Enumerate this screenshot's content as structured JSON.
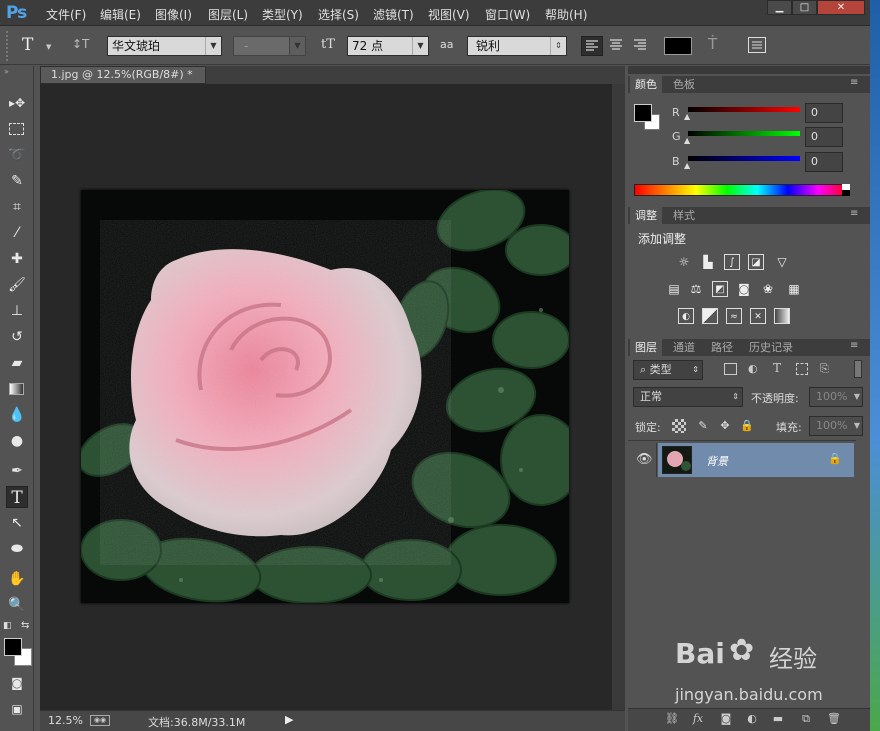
{
  "app": {
    "logo": "Ps"
  },
  "menu": [
    "文件(F)",
    "编辑(E)",
    "图像(I)",
    "图层(L)",
    "类型(Y)",
    "选择(S)",
    "滤镜(T)",
    "视图(V)",
    "窗口(W)",
    "帮助(H)"
  ],
  "window_controls": [
    "minimize-icon",
    "maximize-icon",
    "close-icon"
  ],
  "options": {
    "tool_glyph": "T",
    "orient_glyph": "↕T",
    "font_family": "华文琥珀",
    "font_style": "-",
    "size_glyph": "tT",
    "font_size": "72 点",
    "aa_glyph": "aa",
    "antialias": "锐利",
    "text_color": "#000000"
  },
  "document": {
    "tab_title": "1.jpg @ 12.5%(RGB/8#) *",
    "tab_close": "×",
    "zoom": "12.5%",
    "doc_info": "文档:36.8M/33.1M"
  },
  "color_panel": {
    "tabs": [
      "颜色",
      "色板"
    ],
    "channels": [
      {
        "label": "R",
        "value": "0",
        "gradient": "#ff0000"
      },
      {
        "label": "G",
        "value": "0",
        "gradient": "#00ff00"
      },
      {
        "label": "B",
        "value": "0",
        "gradient": "#0000ff"
      }
    ],
    "foreground": "#000000",
    "background": "#ffffff"
  },
  "adjust_panel": {
    "tabs": [
      "调整",
      "样式"
    ],
    "title": "添加调整",
    "icons": [
      [
        "brightness-icon",
        "levels-icon",
        "curves-icon",
        "exposure-icon",
        "vibrance-icon"
      ],
      [
        "hue-saturation-icon",
        "color-balance-icon",
        "black-white-icon",
        "photo-filter-icon",
        "channel-mixer-icon",
        "color-lookup-icon"
      ],
      [
        "invert-icon",
        "posterize-icon",
        "threshold-icon",
        "selective-color-icon",
        "gradient-map-icon"
      ]
    ]
  },
  "layers_panel": {
    "tabs": [
      "图层",
      "通道",
      "路径",
      "历史记录"
    ],
    "filter_label": "类型",
    "blend_mode": "正常",
    "opacity_label": "不透明度:",
    "opacity_value": "100%",
    "lock_label": "锁定:",
    "fill_label": "填充:",
    "fill_value": "100%",
    "layer_name": "背景",
    "bottom_icons": [
      "link-icon",
      "fx-icon",
      "mask-icon",
      "adjustment-layer-icon",
      "group-folder-icon",
      "new-layer-icon",
      "trash-icon"
    ]
  },
  "watermark": {
    "brand": "Bai",
    "brand_suffix": "经验",
    "url": "jingyan.baidu.com"
  }
}
